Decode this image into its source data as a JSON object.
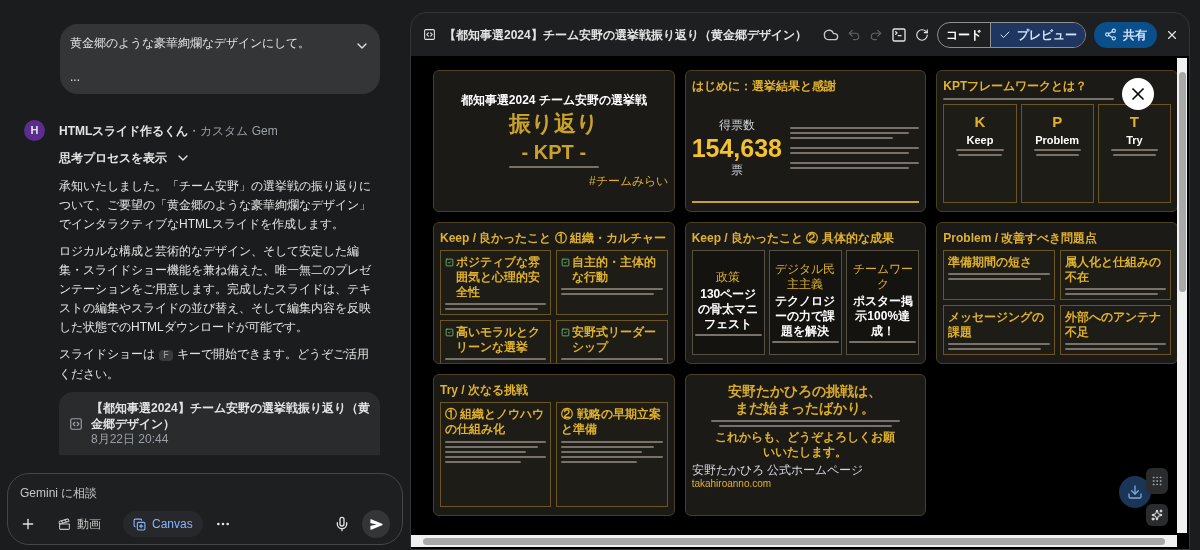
{
  "chat": {
    "user_message": {
      "text": "黄金郷のような豪華絢爛なデザインにして。",
      "more": "..."
    },
    "bot": {
      "avatar": "H",
      "name": "HTMLスライド作るくん",
      "tag": "・カスタム Gem",
      "thinking": "思考プロセスを表示"
    },
    "paragraphs": [
      "承知いたしました。「チーム安野」の選挙戦の振り返りについて、ご要望の「黄金郷のような豪華絢爛なデザイン」でインタラクティブなHTMLスライドを作成します。",
      "ロジカルな構成と芸術的なデザイン、そして安定した編集・スライドショー機能を兼ね備えた、唯一無二のプレゼンテーションをご用意します。完成したスライドは、テキストの編集やスライドの並び替え、そして編集内容を反映した状態でのHTMLダウンロードが可能です。"
    ],
    "key_line": {
      "before": "スライドショーは",
      "key": "F",
      "after": "キーで開始できます。どうぞご活用ください。"
    },
    "artifact": {
      "title": "【都知事選2024】チーム安野の選挙戦振り返り（黄金郷デザイン）",
      "date": "8月22日 20:44"
    },
    "input": {
      "placeholder": "Gemini に相談"
    },
    "tools": [
      {
        "kind": "video",
        "label": "動画",
        "selected": false
      },
      {
        "kind": "canvas",
        "label": "Canvas",
        "selected": true
      }
    ]
  },
  "canvas": {
    "title": "【都知事選2024】チーム安野の選挙戦振り返り（黄金郷デザイン）",
    "tabs": [
      {
        "label": "コード",
        "selected": false
      },
      {
        "label": "プレビュー",
        "selected": true
      }
    ],
    "share": "共有",
    "slides": [
      {
        "kind": "cover",
        "subtitle": "都知事選2024 チーム安野の選挙戦",
        "heading": "振り返り",
        "heading2": "- KPT -",
        "tag": "#チームみらい"
      },
      {
        "kind": "results",
        "title": "はじめに：選挙結果と感謝",
        "label": "得票数",
        "number": "154,638",
        "unit": "票"
      },
      {
        "kind": "kpt",
        "title": "KPTフレームワークとは？",
        "items": [
          {
            "letter": "K",
            "word": "Keep"
          },
          {
            "letter": "P",
            "word": "Problem"
          },
          {
            "letter": "T",
            "word": "Try"
          }
        ]
      },
      {
        "kind": "checks",
        "title": "Keep / 良かったこと ① 組織・カルチャー",
        "items": [
          "ポジティブな雰囲気と心理的安全性",
          "自主的・主体的な行動",
          "高いモラルとクリーンな選挙",
          "安野式リーダーシップ"
        ]
      },
      {
        "kind": "features",
        "title": "Keep / 良かったこと ② 具体的な成果",
        "items": [
          {
            "label": "政策",
            "heading": "130ページの骨太マニフェスト"
          },
          {
            "label": "デジタル民主主義",
            "heading": "テクノロジーの力で課題を解決"
          },
          {
            "label": "チームワーク",
            "heading": "ポスター掲示100%達成！"
          }
        ]
      },
      {
        "kind": "grid",
        "title": "Problem / 改善すべき問題点",
        "items": [
          "準備期間の短さ",
          "属人化と仕組みの不在",
          "メッセージングの課題",
          "外部へのアンテナ不足"
        ]
      },
      {
        "kind": "columns",
        "title": "Try / 次なる挑戦",
        "items": [
          "① 組織とノウハウの仕組み化",
          "② 戦略の早期立案と準備"
        ]
      },
      {
        "kind": "closing",
        "heading": "安野たかひろの挑戦は、まだ始まったばかり。",
        "closing": "これからも、どうぞよろしくお願いいたします。",
        "footer": "安野たかひろ 公式ホームページ",
        "link": "takahiroanno.com"
      }
    ]
  }
}
